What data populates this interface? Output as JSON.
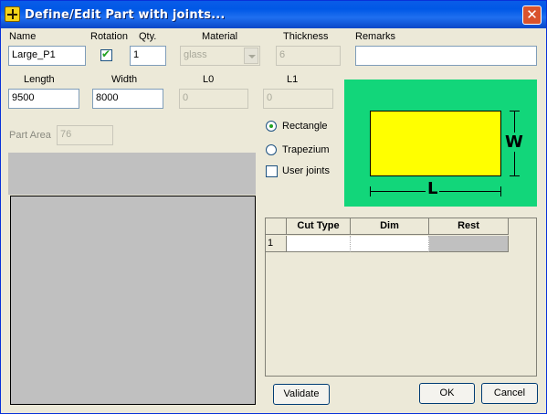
{
  "window": {
    "title": "Define/Edit Part with joints...",
    "close_glyph": "✕"
  },
  "fields": {
    "name": {
      "label": "Name",
      "value": "Large_P1"
    },
    "rotation": {
      "label": "Rotation",
      "checked": true
    },
    "qty": {
      "label": "Qty.",
      "value": "1"
    },
    "material": {
      "label": "Material",
      "value": "glass"
    },
    "thickness": {
      "label": "Thickness",
      "value": "6"
    },
    "remarks": {
      "label": "Remarks",
      "value": ""
    },
    "length": {
      "label": "Length",
      "value": "9500"
    },
    "width": {
      "label": "Width",
      "value": "8000"
    },
    "l0": {
      "label": "L0",
      "value": "0"
    },
    "l1": {
      "label": "L1",
      "value": "0"
    },
    "part_area": {
      "label": "Part Area",
      "value": "76"
    }
  },
  "shape_options": {
    "rectangle": {
      "label": "Rectangle",
      "checked": true
    },
    "trapezium": {
      "label": "Trapezium",
      "checked": false
    },
    "user_joints": {
      "label": "User joints",
      "checked": false
    }
  },
  "diagram": {
    "width_letter": "W",
    "length_letter": "L",
    "background": "#12d67a",
    "fill": "#ffff00"
  },
  "joints_grid": {
    "columns": [
      "Cut Type",
      "Dim",
      "Rest"
    ],
    "rows": [
      {
        "num": "1",
        "cut_type": "",
        "dim": "",
        "rest": ""
      }
    ]
  },
  "buttons": {
    "validate": "Validate",
    "ok": "OK",
    "cancel": "Cancel"
  }
}
